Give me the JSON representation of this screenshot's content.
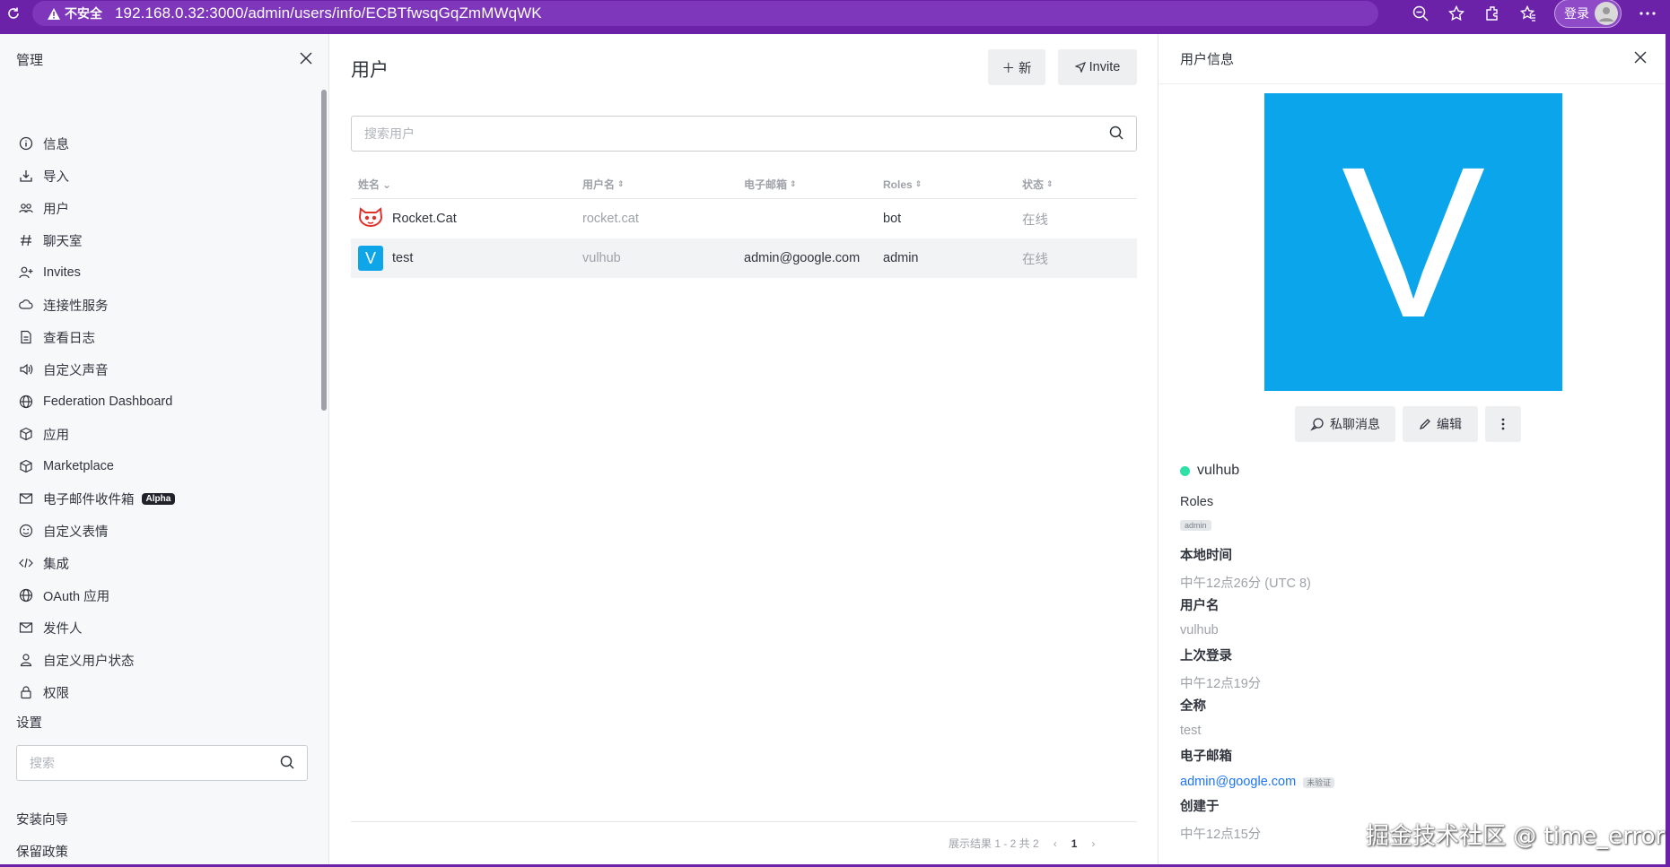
{
  "browser": {
    "insecure_label": "不安全",
    "url": "192.168.0.32:3000/admin/users/info/ECBTfwsqGqZmMWqWK",
    "login_label": "登录"
  },
  "sidebar": {
    "title": "管理",
    "items": [
      {
        "label": "信息",
        "icon": "info-icon"
      },
      {
        "label": "导入",
        "icon": "download-icon"
      },
      {
        "label": "用户",
        "icon": "team-icon"
      },
      {
        "label": "聊天室",
        "icon": "hashtag-icon"
      },
      {
        "label": "Invites",
        "icon": "user-plus-icon"
      },
      {
        "label": "连接性服务",
        "icon": "cloud-icon"
      },
      {
        "label": "查看日志",
        "icon": "file-icon"
      },
      {
        "label": "自定义声音",
        "icon": "sound-icon"
      },
      {
        "label": "Federation Dashboard",
        "icon": "globe-icon"
      },
      {
        "label": "应用",
        "icon": "cube-icon"
      },
      {
        "label": "Marketplace",
        "icon": "cube-icon"
      },
      {
        "label": "电子邮件收件箱",
        "icon": "mail-icon",
        "badge": "Alpha"
      },
      {
        "label": "自定义表情",
        "icon": "emoji-icon"
      },
      {
        "label": "集成",
        "icon": "code-icon"
      },
      {
        "label": "OAuth 应用",
        "icon": "globe-icon"
      },
      {
        "label": "发件人",
        "icon": "mail-icon"
      },
      {
        "label": "自定义用户状态",
        "icon": "user-icon"
      },
      {
        "label": "权限",
        "icon": "lock-icon"
      }
    ],
    "settings_label": "设置",
    "search_placeholder": "搜索",
    "setup_wizard": "安装向导",
    "retention": "保留政策"
  },
  "main": {
    "title": "用户",
    "new_button": "新",
    "invite_button": "Invite",
    "search_placeholder": "搜索用户",
    "columns": [
      "姓名",
      "用户名",
      "电子邮箱",
      "Roles",
      "状态"
    ],
    "rows": [
      {
        "name": "Rocket.Cat",
        "username": "rocket.cat",
        "email": "",
        "roles": "bot",
        "status": "在线"
      },
      {
        "name": "test",
        "avatar_letter": "V",
        "username": "vulhub",
        "email": "admin@google.com",
        "roles": "admin",
        "status": "在线"
      }
    ],
    "pagination": {
      "summary": "展示结果 1 - 2 共 2",
      "current_page": "1"
    }
  },
  "panel": {
    "title": "用户信息",
    "avatar_letter": "V",
    "dm_button": "私聊消息",
    "edit_button": "编辑",
    "username": "vulhub",
    "roles_label": "Roles",
    "role_tag": "admin",
    "local_time_label": "本地时间",
    "local_time": "中午12点26分 (UTC 8)",
    "username_label": "用户名",
    "username_value": "vulhub",
    "last_login_label": "上次登录",
    "last_login": "中午12点19分",
    "fullname_label": "全称",
    "fullname": "test",
    "email_label": "电子邮箱",
    "email": "admin@google.com",
    "unverified": "未验证",
    "created_label": "创建于",
    "created": "中午12点15分"
  },
  "watermark": "掘金技术社区 @ time_error",
  "colors": {
    "accent": "#0ba5ec",
    "online": "#2de0a5",
    "browser": "#6b21a8",
    "link": "#1d74f5"
  }
}
